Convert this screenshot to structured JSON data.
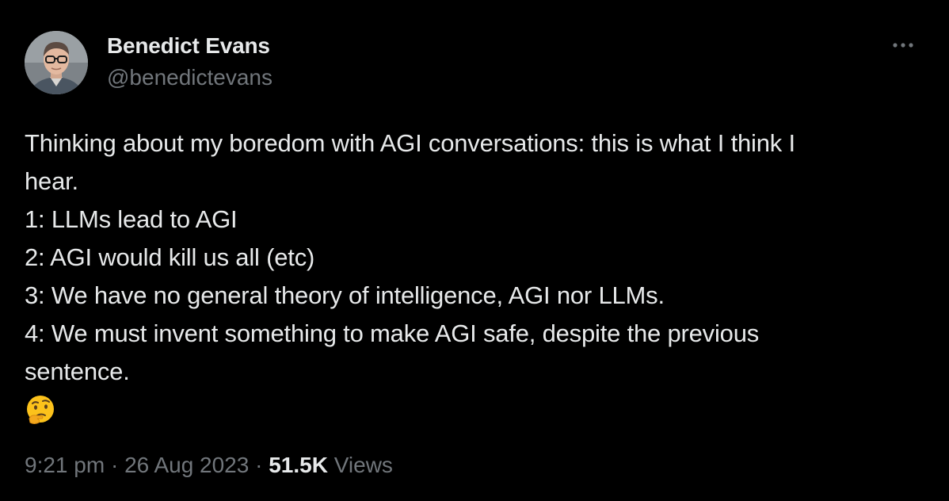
{
  "author": {
    "name": "Benedict Evans",
    "handle": "@benedictevans",
    "avatar_icon": "profile-photo"
  },
  "more_icon": "ellipsis-icon",
  "tweet": {
    "lines": [
      "Thinking about my boredom with AGI conversations: this is what I think I",
      "hear.",
      "1: LLMs lead to AGI",
      "2: AGI would kill us all (etc)",
      "3: We have no general theory of intelligence, AGI nor LLMs.",
      "4: We must invent something to make AGI safe, despite the previous",
      "sentence."
    ],
    "emoji": "thinking-face"
  },
  "meta": {
    "time": "9:21 pm",
    "separator": " · ",
    "date": "26 Aug 2023",
    "views_count": "51.5K",
    "views_label": "Views"
  },
  "colors": {
    "background": "#000000",
    "primary_text": "#e7e9ea",
    "secondary_text": "#71767b"
  }
}
